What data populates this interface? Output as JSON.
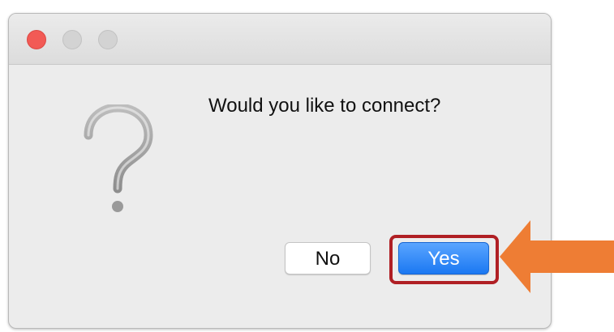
{
  "dialog": {
    "message": "Would you like to connect?",
    "icon": "question-mark-icon",
    "buttons": {
      "no_label": "No",
      "yes_label": "Yes"
    },
    "traffic_lights": [
      "close",
      "minimize",
      "zoom"
    ]
  },
  "annotation": {
    "highlight_target": "yes-button",
    "highlight_color": "#b01f24",
    "arrow_color": "#ee7d34"
  },
  "colors": {
    "dialog_bg": "#ececec",
    "close_button": "#f25a55",
    "inactive_traffic": "#d3d3d3",
    "primary_button": "#1b78f2"
  }
}
